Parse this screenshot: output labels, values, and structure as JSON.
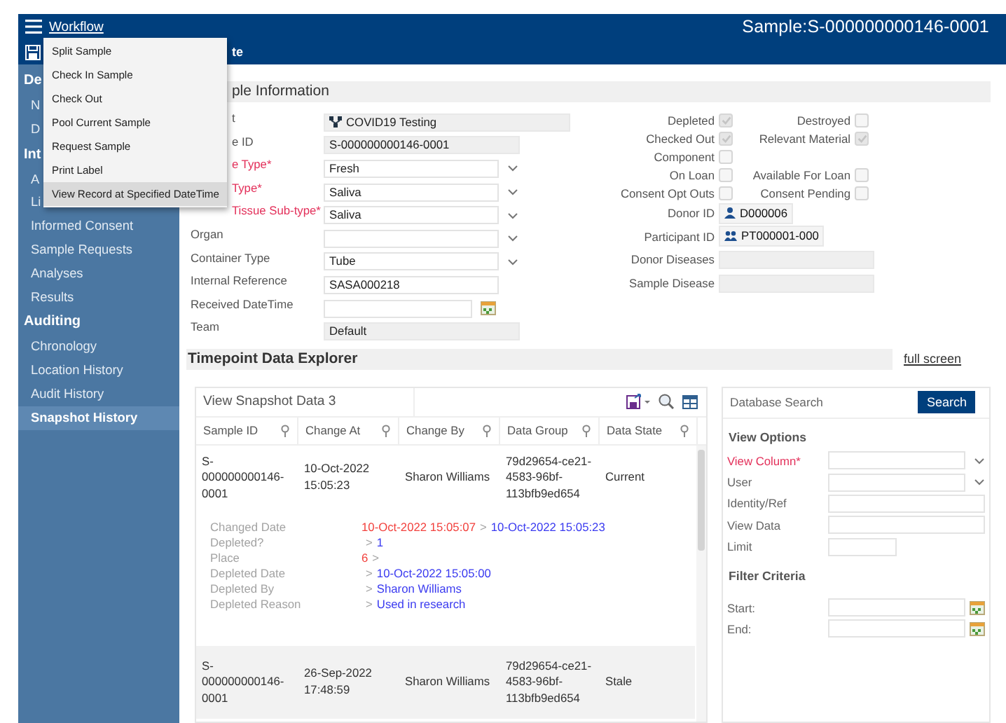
{
  "header": {
    "menu_label": "Workflow",
    "title": "Sample:S-000000000146-0001",
    "toolbar_label": "te"
  },
  "workflow_menu": [
    {
      "label": "Split Sample",
      "selected": false
    },
    {
      "label": "Check In Sample",
      "selected": false
    },
    {
      "label": "Check Out",
      "selected": false
    },
    {
      "label": "Pool Current Sample",
      "selected": false
    },
    {
      "label": "Request Sample",
      "selected": false
    },
    {
      "label": "Print Label",
      "selected": false
    },
    {
      "label": "View Record at Specified DateTime",
      "selected": true
    }
  ],
  "sidebar": {
    "groups": [
      {
        "title": "De",
        "items": [
          {
            "label": "N",
            "selected": false
          },
          {
            "label": "D",
            "selected": false
          }
        ]
      },
      {
        "title": "Int",
        "items": [
          {
            "label": "A",
            "selected": false
          },
          {
            "label": "Li",
            "selected": false
          },
          {
            "label": "Informed Consent",
            "selected": false
          },
          {
            "label": "Sample Requests",
            "selected": false
          },
          {
            "label": "Analyses",
            "selected": false
          },
          {
            "label": "Results",
            "selected": false
          }
        ]
      },
      {
        "title": "Auditing",
        "items": [
          {
            "label": "Chronology",
            "selected": false
          },
          {
            "label": "Location History",
            "selected": false
          },
          {
            "label": "Audit History",
            "selected": false
          },
          {
            "label": "Snapshot History",
            "selected": true
          }
        ]
      }
    ]
  },
  "sample_information": {
    "title": "ple Information",
    "fields": [
      {
        "label": "t",
        "kind": "project",
        "value": "COVID19 Testing",
        "required": false
      },
      {
        "label": "e ID",
        "kind": "readonly",
        "value": "S-000000000146-0001",
        "required": false
      },
      {
        "label": "e Type*",
        "kind": "dropdown",
        "value": "Fresh",
        "required": true
      },
      {
        "label": "Type*",
        "kind": "dropdown",
        "value": "Saliva",
        "required": true
      },
      {
        "label": "Tissue Sub-type*",
        "kind": "dropdown",
        "value": "Saliva",
        "required": true
      },
      {
        "label": "Organ",
        "kind": "dropdown",
        "required": false
      },
      {
        "label": "Container Type",
        "kind": "dropdown",
        "value": "Tube",
        "required": false
      },
      {
        "label": "Internal Reference",
        "kind": "text",
        "value": "SASA000218",
        "required": false
      },
      {
        "label": "Received DateTime",
        "kind": "date",
        "required": false
      },
      {
        "label": "Team",
        "kind": "readonly",
        "value": "Default",
        "required": false
      }
    ],
    "flags": [
      [
        {
          "label": "Depleted",
          "checked": true
        },
        {
          "label": "Destroyed",
          "checked": false
        }
      ],
      [
        {
          "label": "Checked Out",
          "checked": true
        },
        {
          "label": "Relevant Material",
          "checked": true
        }
      ],
      [
        {
          "label": "Component",
          "checked": false
        }
      ],
      [
        {
          "label": "On Loan",
          "checked": false
        },
        {
          "label": "Available For Loan",
          "checked": false
        }
      ],
      [
        {
          "label": "Consent Opt Outs",
          "checked": false
        },
        {
          "label": "Consent Pending",
          "checked": false
        }
      ]
    ],
    "ids": [
      {
        "label": "Donor ID",
        "kind": "person",
        "value": "D000006"
      },
      {
        "label": "Participant ID",
        "kind": "group",
        "value": "PT000001-000"
      }
    ],
    "diseases": [
      {
        "label": "Donor Diseases"
      },
      {
        "label": "Sample Disease"
      }
    ]
  },
  "timepoint_explorer": {
    "title": "Timepoint Data Explorer",
    "link": "full screen",
    "grid": {
      "title": "View Snapshot Data 3",
      "columns": [
        "Sample ID",
        "Change At",
        "Change By",
        "Data Group",
        "Data State"
      ],
      "rows": [
        {
          "selected": false,
          "cells": [
            "S-000000000146-0001",
            "10-Oct-2022 15:05:23",
            "Sharon Williams",
            "79d29654-ce21-4583-96bf-113bfb9ed654",
            "Current"
          ],
          "details": [
            {
              "label": "Changed Date",
              "old": "10-Oct-2022 15:05:07",
              "sep": ">",
              "new": "10-Oct-2022 15:05:23"
            },
            {
              "label": "Depleted?",
              "sep": ">",
              "new": "1"
            },
            {
              "label": "Place",
              "old": "6",
              "sep": ">"
            },
            {
              "label": "Depleted Date",
              "sep": ">",
              "new": "10-Oct-2022 15:05:00"
            },
            {
              "label": "Depleted By",
              "sep": ">",
              "new": "Sharon Williams"
            },
            {
              "label": "Depleted Reason",
              "sep": ">",
              "new": "Used in research"
            }
          ]
        },
        {
          "selected": true,
          "cells": [
            "S-000000000146-0001",
            "26-Sep-2022 17:48:59",
            "Sharon Williams",
            "79d29654-ce21-4583-96bf-113bfb9ed654",
            "Stale"
          ]
        }
      ]
    }
  },
  "search_panel": {
    "placeholder": "Database Search",
    "button": "Search",
    "options_title": "View Options",
    "fields": [
      {
        "label": "View Column*",
        "kind": "dropdown",
        "required": true
      },
      {
        "label": "User",
        "kind": "dropdown",
        "required": false
      },
      {
        "label": "Identity/Ref",
        "kind": "text",
        "required": false
      },
      {
        "label": "View Data",
        "kind": "text",
        "required": false
      },
      {
        "label": "Limit",
        "kind": "short",
        "required": false
      }
    ],
    "filter_title": "Filter Criteria",
    "filters": [
      {
        "label": "Start:",
        "kind": "date"
      },
      {
        "label": "End:",
        "kind": "date"
      }
    ]
  }
}
